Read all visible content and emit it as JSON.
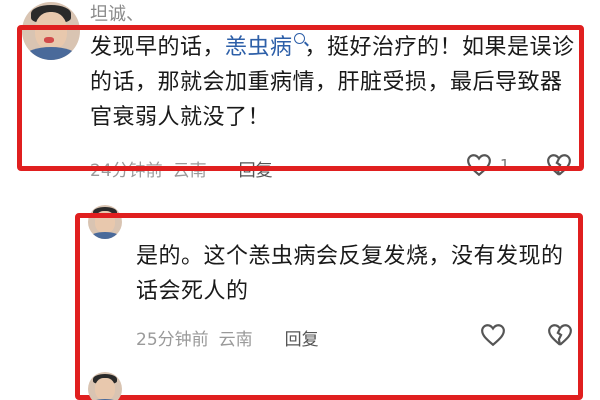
{
  "comments": [
    {
      "username": "坦诚、",
      "text_before": "发现早的话，",
      "keyword": "恙虫病",
      "text_after": "，挺好治疗的！如果是误诊的话，那就会加重病情，肝脏受损，最后导致器官衰弱人就没了！",
      "time": "24分钟前",
      "location": "云南",
      "reply_label": "回复",
      "like_count": "1",
      "icons": [
        "heart-icon",
        "broken-heart-icon",
        "search-icon"
      ]
    },
    {
      "username": "",
      "text": "是的。这个恙虫病会反复发烧，没有发现的话会死人的",
      "time": "25分钟前",
      "location": "云南",
      "reply_label": "回复",
      "icons": [
        "heart-icon",
        "broken-heart-icon"
      ]
    }
  ],
  "colors": {
    "highlight_border": "#e01f1f",
    "keyword_link": "#2d5fa8",
    "meta_text": "#9a9a9a"
  }
}
